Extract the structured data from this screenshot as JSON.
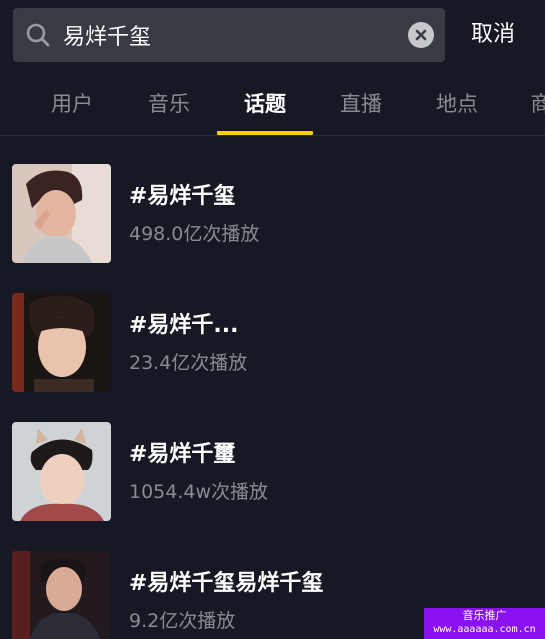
{
  "search": {
    "query": "易烊千玺",
    "cancel_label": "取消"
  },
  "tabs": [
    {
      "label": "用户",
      "active": false
    },
    {
      "label": "音乐",
      "active": false
    },
    {
      "label": "话题",
      "active": true
    },
    {
      "label": "直播",
      "active": false
    },
    {
      "label": "地点",
      "active": false
    },
    {
      "label": "商",
      "active": false
    }
  ],
  "results": [
    {
      "title": "#易烊千玺",
      "plays": "498.0亿次播放",
      "thumb_icon": "avatar-photo"
    },
    {
      "title": "#易烊千...",
      "plays": "23.4亿次播放",
      "thumb_icon": "avatar-photo"
    },
    {
      "title": "#易烊千璽",
      "plays": "1054.4w次播放",
      "thumb_icon": "avatar-photo"
    },
    {
      "title": "#易烊千玺易烊千玺",
      "plays": "9.2亿次播放",
      "thumb_icon": "avatar-photo"
    }
  ],
  "watermark": {
    "line1": "音乐推广",
    "line2": "www.aaaaaa.com.cn"
  },
  "colors": {
    "background": "#161823",
    "search_bg": "#393b44",
    "tab_indicator": "#face15",
    "muted_text": "#8a8b91",
    "watermark_bg": "#8a12f0"
  }
}
